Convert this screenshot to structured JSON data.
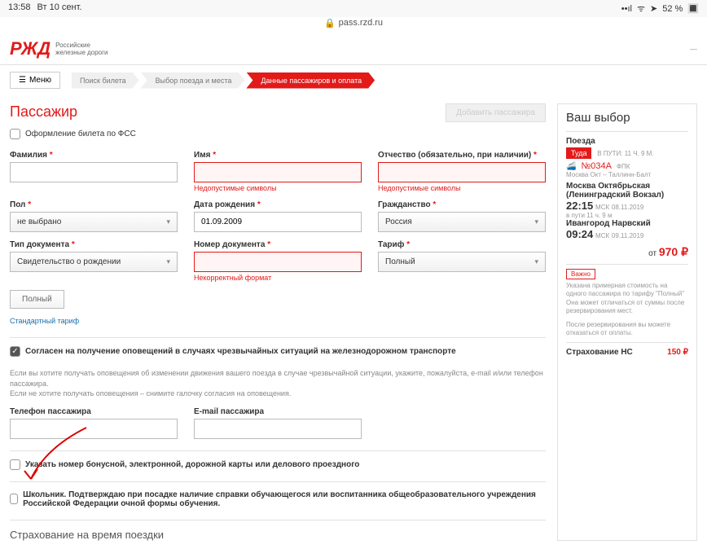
{
  "status": {
    "time": "13:58",
    "date": "Вт 10 сент.",
    "battery": "52 %",
    "signal": "••ıl",
    "wifi": "⌃",
    "send": "✈"
  },
  "url": {
    "host": "pass.rzd.ru"
  },
  "header": {
    "brand_mark": "РЖД",
    "brand_line1": "Российские",
    "brand_line2": "железные дороги",
    "menu": "Меню"
  },
  "steps": {
    "s1": "Поиск билета",
    "s2": "Выбор поезда и места",
    "s3": "Данные пассажиров и оплата"
  },
  "title": "Пассажир",
  "add_btn": "Добавить пассажира",
  "fss_label": "Оформление билета по ФСС",
  "fields": {
    "lastname": "Фамилия",
    "firstname": "Имя",
    "middlename": "Отчество (обязательно, при наличии)",
    "gender": "Пол",
    "birthdate": "Дата рождения",
    "citizenship": "Гражданство",
    "doctype": "Тип документа",
    "docnum": "Номер документа",
    "tariff": "Тариф"
  },
  "values": {
    "gender": "не выбрано",
    "birthdate": "01.09.2009",
    "citizenship": "Россия",
    "doctype": "Свидетельство о рождении",
    "tariff": "Полный"
  },
  "errors": {
    "invalid_chars": "Недопустимые символы",
    "bad_format": "Некорректный формат"
  },
  "tariff_btn": "Полный",
  "tariff_link": "Стандартный тариф",
  "consent": "Согласен на получение оповещений в случаях чрезвычайных ситуаций на железнодорожном транспорте",
  "consent_note1": "Если вы хотите получать оповещения об изменении движения вашего поезда в случае чрезвычайной ситуации, укажите, пожалуйста, e-mail и/или телефон пассажира.",
  "consent_note2": "Если не хотите получать оповещения – снимите галочку согласия на оповещения.",
  "phone_label": "Телефон пассажира",
  "email_label": "E-mail пассажира",
  "bonus_label": "Указать номер бонусной, электронной, дорожной карты или делового проездного",
  "school_label": "Школьник. Подтверждаю при посадке наличие справки обучающегося или воспитанника общеобразовательного учреждения Российской Федерации очной формы обучения.",
  "insurance_heading": "Страхование на время поездки",
  "sidebar": {
    "title": "Ваш выбор",
    "trains": "Поезда",
    "dir": "Туда",
    "duration": "В ПУТИ: 11 Ч. 9 М.",
    "train_num": "№034А",
    "train_type": "ФПК",
    "route_small": "Москва Окт – Таллинн-Балт",
    "station_from": "Москва Октябрьская (Ленинградский Вокзал)",
    "time_from": "22:15",
    "tz": "МСК",
    "date_from": "08.11.2019",
    "dur2": "в пути 11 ч. 9 м",
    "station_to": "Ивангород Нарвский",
    "time_to": "09:24",
    "date_to": "09.11.2019",
    "from_label": "от",
    "price": "970 ₽",
    "important": "Важно",
    "note": "Указана примерная стоимость на одного пассажира по тарифу \"Полный\" Она может отличаться от суммы после резервирования мест.",
    "note2": "После резервирования вы можете отказаться от оплаты.",
    "ins_label": "Страхование НС",
    "ins_price": "150 ₽"
  }
}
